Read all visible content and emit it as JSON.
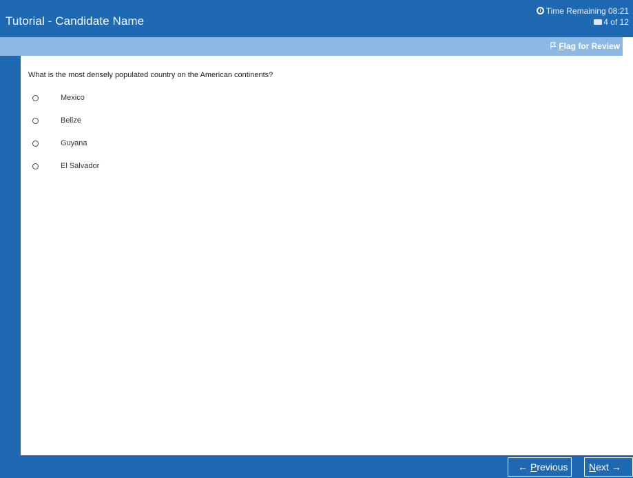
{
  "header": {
    "title": "Tutorial - Candidate Name",
    "timer_label": "Time Remaining",
    "timer_value": "08:21",
    "progress": "4 of 12",
    "icons": {
      "timer": "clock-icon",
      "progress": "printer-icon"
    }
  },
  "subbar": {
    "flag_first_letter": "F",
    "flag_rest": "lag for Review",
    "flag_icon": "flag-icon"
  },
  "question": {
    "text": "What is the most densely populated country on the American continents?",
    "options": [
      "Mexico",
      "Belize",
      "Guyana",
      "El Salvador"
    ]
  },
  "footer": {
    "previous_first_letter": "P",
    "previous_rest": "revious",
    "next_first_letter": "N",
    "next_rest": "ext"
  },
  "colors": {
    "primary": "#1f69b3",
    "subbar": "#8eb8e4",
    "background": "#ffffff"
  }
}
